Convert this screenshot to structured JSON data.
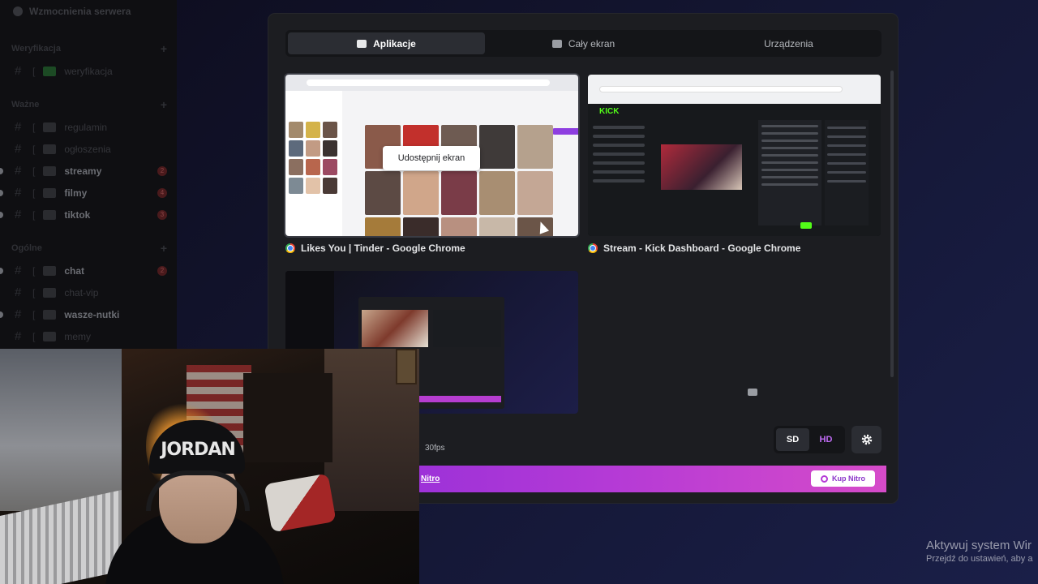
{
  "sidebar": {
    "server_boost": "Wzmocnienia serwera",
    "categories": [
      {
        "name": "Weryfikacja",
        "channels": [
          {
            "name": "weryfikacja",
            "unread": false,
            "badge": ""
          }
        ]
      },
      {
        "name": "Ważne",
        "channels": [
          {
            "name": "regulamin",
            "unread": false,
            "badge": ""
          },
          {
            "name": "ogłoszenia",
            "unread": false,
            "badge": ""
          },
          {
            "name": "streamy",
            "unread": true,
            "badge": "2"
          },
          {
            "name": "filmy",
            "unread": true,
            "badge": "4"
          },
          {
            "name": "tiktok",
            "unread": true,
            "badge": "3"
          }
        ]
      },
      {
        "name": "Ogólne",
        "channels": [
          {
            "name": "chat",
            "unread": true,
            "badge": "2"
          },
          {
            "name": "chat-vip",
            "unread": false,
            "badge": ""
          },
          {
            "name": "wasze-nutki",
            "unread": true,
            "badge": ""
          },
          {
            "name": "memy",
            "unread": false,
            "badge": ""
          },
          {
            "name": "shoty",
            "unread": false,
            "badge": ""
          }
        ]
      }
    ]
  },
  "modal": {
    "tabs": [
      {
        "label": "Aplikacje",
        "icon": "app-window-icon",
        "active": true
      },
      {
        "label": "Cały ekran",
        "icon": "monitor-icon",
        "active": false
      },
      {
        "label": "Urządzenia",
        "icon": "camera-icon",
        "active": false
      }
    ],
    "windows": [
      {
        "label": "Likes You | Tinder - Google Chrome",
        "icon": "chrome-icon",
        "hover_label": "Udostępnij ekran",
        "selected": true
      },
      {
        "label": "Stream - Kick Dashboard - Google Chrome",
        "icon": "chrome-icon",
        "kick_logo": "KICK",
        "selected": false
      },
      {
        "label": "",
        "icon": "",
        "selected": false
      }
    ],
    "fps": "30fps",
    "quality": {
      "options": [
        "SD",
        "HD"
      ],
      "selected": "SD"
    },
    "nitro": {
      "link_text": "Nitro",
      "button_label": "Kup Nitro"
    }
  },
  "watermark": {
    "line1": "Aktywuj system Wir",
    "line2": "Przejdź do ustawień, aby a"
  },
  "webcam": {
    "beanie_text": "JORDAN"
  },
  "colors": {
    "accent": "#b43ad6",
    "kick_green": "#53fc18",
    "modal_bg": "#1c1d21"
  }
}
